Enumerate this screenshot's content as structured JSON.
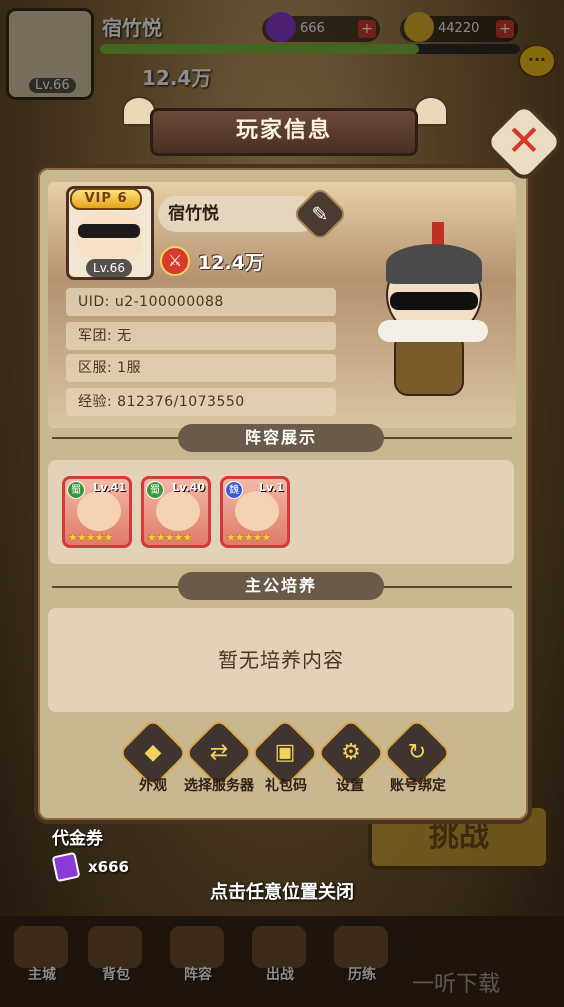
{
  "background": {
    "player_name": "宿竹悦",
    "player_level": "Lv.66",
    "gems": "666",
    "gold": "44220",
    "power": "12.4万",
    "challenge_button": "挑战",
    "nav": [
      "主城",
      "背包",
      "阵容",
      "出战",
      "历练",
      "",
      ""
    ],
    "watermark": "一听下载"
  },
  "dialog": {
    "title": "玩家信息",
    "profile": {
      "vip": "VIP  6",
      "level": "Lv.66",
      "name": "宿竹悦",
      "power": "12.4万",
      "uid": "UID:   u2-100000088",
      "legion": "军团:  无",
      "server": "区服:  1服",
      "exp": "经验:  812376/1073550"
    },
    "lineup_title": "阵容展示",
    "lineup": [
      {
        "faction": "蜀",
        "level": "Lv.41",
        "stars": "★★★★★",
        "faction_color": "#3a9a3a"
      },
      {
        "faction": "蜀",
        "level": "Lv.40",
        "stars": "★★★★★",
        "faction_color": "#3a9a3a"
      },
      {
        "faction": "魏",
        "level": "Lv.1",
        "stars": "★★★★★",
        "faction_color": "#3a5ad6"
      }
    ],
    "training_title": "主公培养",
    "training_empty": "暂无培养内容",
    "actions": [
      {
        "label": "外观",
        "icon": "appearance-icon"
      },
      {
        "label": "选择服务器",
        "icon": "server-switch-icon"
      },
      {
        "label": "礼包码",
        "icon": "gift-code-icon"
      },
      {
        "label": "设置",
        "icon": "gear-icon"
      },
      {
        "label": "账号绑定",
        "icon": "account-bind-icon"
      }
    ]
  },
  "voucher": {
    "label": "代金券",
    "count": "x666"
  },
  "close_hint": "点击任意位置关闭"
}
